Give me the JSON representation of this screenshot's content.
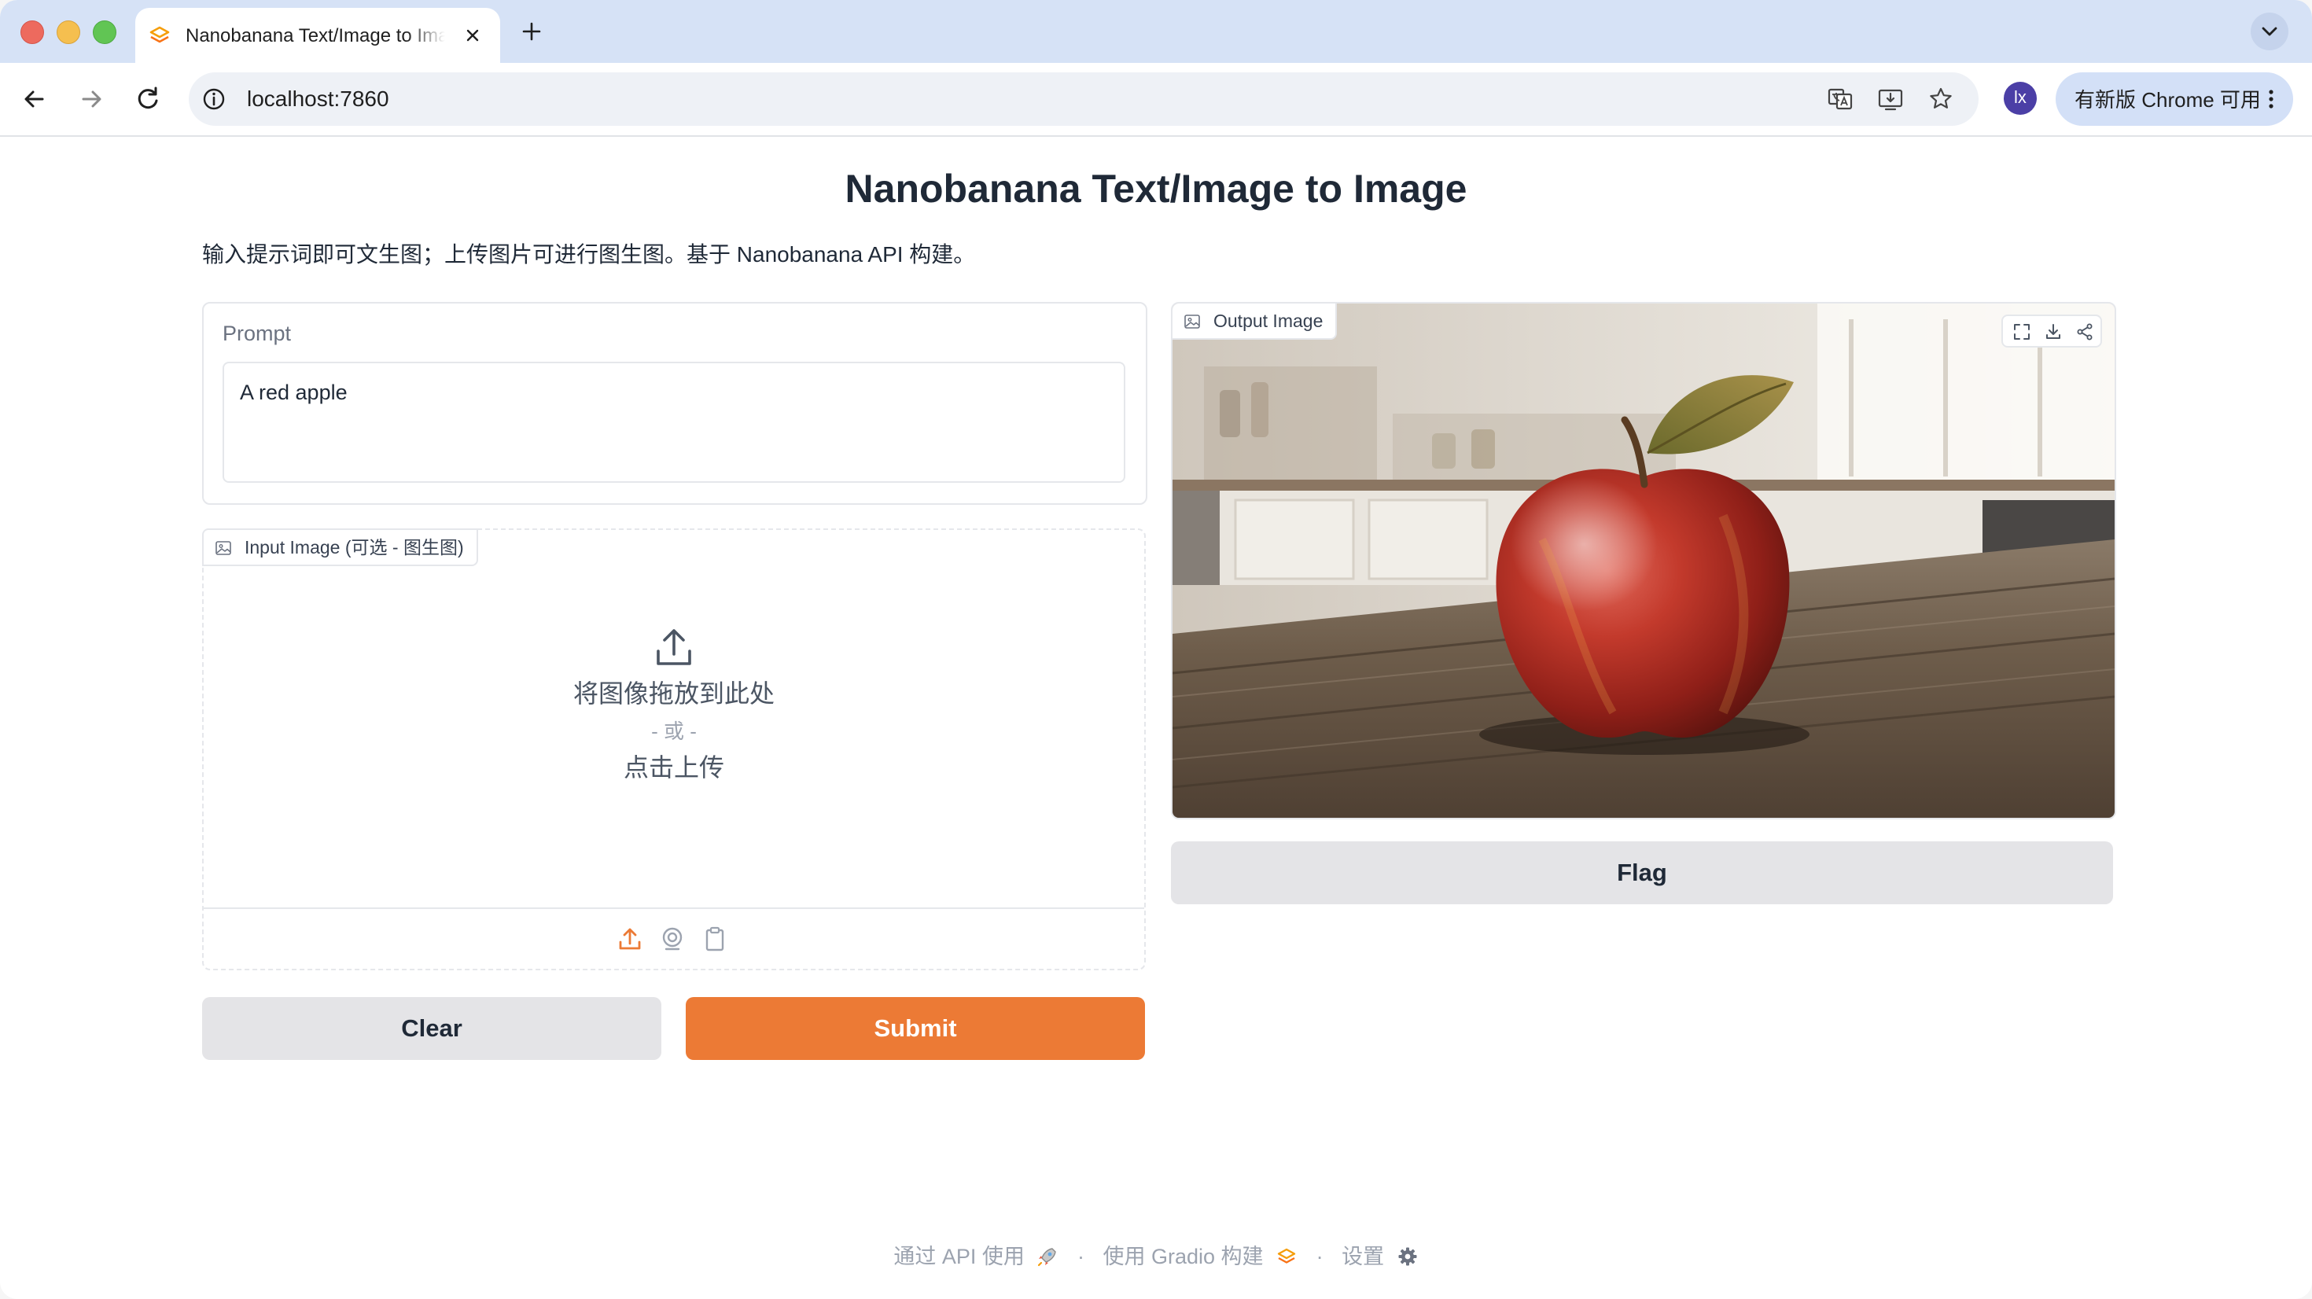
{
  "browser": {
    "tab_title": "Nanobanana Text/Image to Image",
    "url": "localhost:7860",
    "profile_initials": "lx",
    "update_label": "有新版 Chrome 可用"
  },
  "app": {
    "title": "Nanobanana Text/Image to Image",
    "description": "输入提示词即可文生图；上传图片可进行图生图。基于 Nanobanana API 构建。",
    "accent_color": "#ec7a35"
  },
  "prompt": {
    "label": "Prompt",
    "value": "A red apple",
    "placeholder": ""
  },
  "input_image": {
    "label": "Input Image (可选 - 图生图)",
    "drop_text": "将图像拖放到此处",
    "or_text": "- 或 -",
    "click_text": "点击上传",
    "sources": [
      "upload-icon",
      "webcam-icon",
      "clipboard-icon"
    ]
  },
  "output_image": {
    "label": "Output Image",
    "tools": [
      "fullscreen-icon",
      "download-icon",
      "share-icon"
    ]
  },
  "buttons": {
    "clear": "Clear",
    "submit": "Submit",
    "flag": "Flag"
  },
  "footer": {
    "api": "通过 API 使用",
    "built_with": "使用 Gradio 构建",
    "settings": "设置",
    "separator": "·"
  }
}
